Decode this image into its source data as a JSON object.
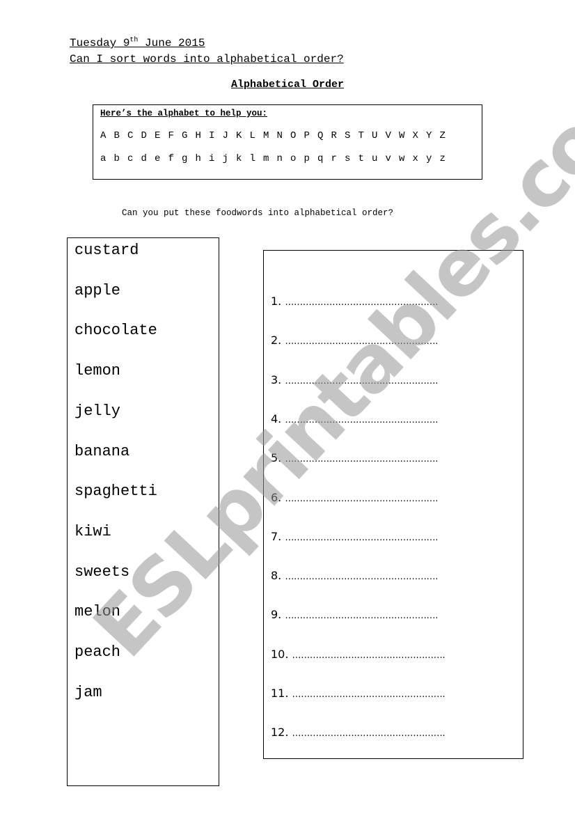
{
  "header": {
    "date_day": "Tuesday 9",
    "date_suffix": "th",
    "date_rest": " June 2015",
    "learning_objective": "Can I sort words into alphabetical order?"
  },
  "title": "Alphabetical Order",
  "alphabet_box": {
    "heading": "Here’s the alphabet to help you:",
    "uppercase": [
      "A",
      "B",
      "C",
      "D",
      "E",
      "F",
      "G",
      "H",
      "I",
      "J",
      "K",
      "L",
      "M",
      "N",
      "O",
      "P",
      "Q",
      "R",
      "S",
      "T",
      "U",
      "V",
      "W",
      "X",
      "Y",
      "Z"
    ],
    "lowercase": [
      "a",
      "b",
      "c",
      "d",
      "e",
      "f",
      "g",
      "h",
      "i",
      "j",
      "k",
      "l",
      "m",
      "n",
      "o",
      "p",
      "q",
      "r",
      "s",
      "t",
      "u",
      "v",
      "w",
      "x",
      "y",
      "z"
    ]
  },
  "instruction": "Can you put these foodwords into alphabetical order?",
  "words": [
    "custard",
    "apple",
    "chocolate",
    "lemon",
    "jelly",
    "banana",
    "spaghetti",
    "kiwi",
    "sweets",
    "melon",
    "peach",
    "jam"
  ],
  "answers": [
    {
      "number": "1.",
      "line": "……………………………………………."
    },
    {
      "number": "2.",
      "line": "……………………………………………."
    },
    {
      "number": "3.",
      "line": "……………………………………………."
    },
    {
      "number": "4.",
      "line": "……………………………………………."
    },
    {
      "number": "5.",
      "line": "……………………………………………."
    },
    {
      "number": "6.",
      "line": "……………………………………………."
    },
    {
      "number": "7.",
      "line": "……………………………………………."
    },
    {
      "number": "8.",
      "line": "……………………………………………."
    },
    {
      "number": "9.",
      "line": "……………………………………………."
    },
    {
      "number": "10.",
      "line": "……………………………………………."
    },
    {
      "number": "11.",
      "line": "……………………………………………."
    },
    {
      "number": "12.",
      "line": "……………………………………………."
    }
  ],
  "watermark": "ESLprintables.com"
}
